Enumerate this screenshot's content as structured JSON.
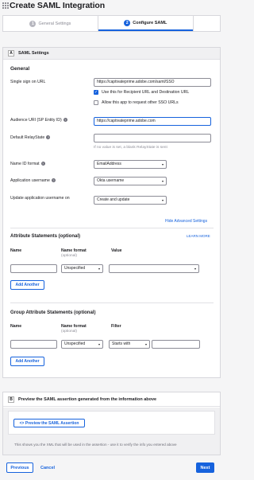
{
  "page": {
    "title": "Create SAML Integration"
  },
  "steps": [
    {
      "num": "1",
      "label": "General Settings"
    },
    {
      "num": "2",
      "label": "Configure SAML"
    }
  ],
  "section_a": {
    "letter": "A",
    "title": "SAML Settings",
    "general_heading": "General",
    "sso_url": {
      "label": "Single sign on URL",
      "value": "https://captivateprime.adobe.com/saml/SSO",
      "use_for_recipient": "Use this for Recipient URL and Destination URL",
      "allow_other": "Allow this app to request other SSO URLs"
    },
    "audience": {
      "label": "Audience URI (SP Entity ID)",
      "value": "https://captivateprime.adobe.com"
    },
    "relay": {
      "label": "Default RelayState",
      "value": "",
      "hint": "If no value is set, a blank RelayState is sent"
    },
    "name_id": {
      "label": "Name ID format",
      "value": "EmailAddress"
    },
    "app_username": {
      "label": "Application username",
      "value": "Okta username"
    },
    "update_username": {
      "label": "Update application username on",
      "value": "Create and update"
    },
    "advanced_link": "Hide Advanced Settings",
    "attr": {
      "heading": "Attribute Statements (optional)",
      "learn_more": "LEARN MORE",
      "col_name": "Name",
      "col_format": "Name format",
      "col_format_sub": "(optional)",
      "col_value": "Value",
      "format_value": "Unspecified",
      "add_button": "Add Another"
    },
    "group": {
      "heading": "Group Attribute Statements (optional)",
      "col_name": "Name",
      "col_format": "Name format",
      "col_format_sub": "(optional)",
      "col_filter": "Filter",
      "format_value": "Unspecified",
      "filter_value": "Starts with",
      "add_button": "Add Another"
    }
  },
  "section_b": {
    "letter": "B",
    "title": "Preview the SAML assertion generated from the information above",
    "preview_button": "<> Preview the SAML Assertion",
    "note": "This shows you the XML that will be used in the assertion - use it to verify the info you entered above"
  },
  "footer": {
    "previous": "Previous",
    "cancel": "Cancel",
    "next": "Next"
  }
}
